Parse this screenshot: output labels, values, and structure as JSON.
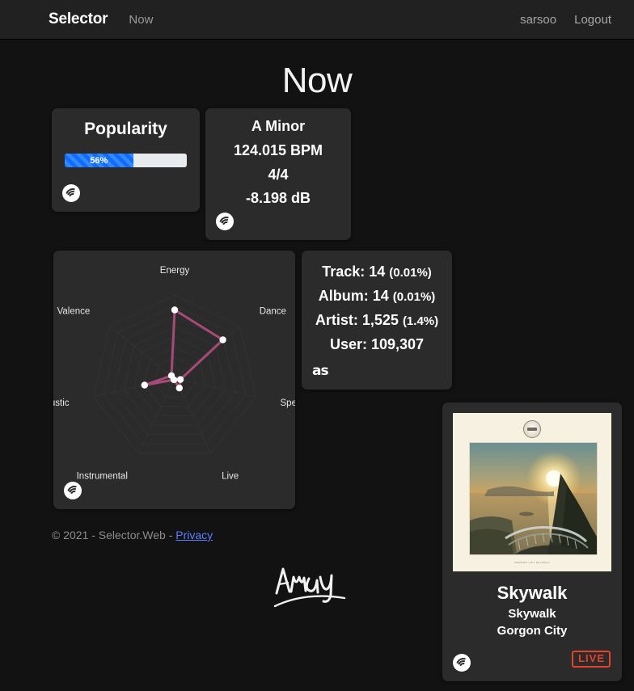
{
  "navbar": {
    "brand": "Selector",
    "page_link": "Now",
    "username": "sarsoo",
    "logout": "Logout"
  },
  "page": {
    "title": "Now"
  },
  "popularity_card": {
    "heading": "Popularity",
    "value_label": "56%",
    "value": 56,
    "source_icon": "spotify-icon",
    "bar_color": "#0d6efd",
    "track_color": "#e9ecef"
  },
  "key_card": {
    "lines": [
      "A Minor",
      "124.015 BPM",
      "4/4",
      "-8.198 dB"
    ],
    "source_icon": "spotify-icon"
  },
  "counts_card": {
    "rows": [
      {
        "label": "Track: 14",
        "pct": "(0.01%)"
      },
      {
        "label": "Album: 14",
        "pct": "(0.01%)"
      },
      {
        "label": "Artist: 1,525",
        "pct": "(1.4%)"
      },
      {
        "label": "User: 109,307",
        "pct": ""
      }
    ],
    "source_icon": "lastfm-icon",
    "lastfm_glyph": "as"
  },
  "radar_card": {
    "source_icon": "spotify-icon"
  },
  "chart_data": {
    "type": "radar",
    "title": "",
    "categories": [
      "Energy",
      "Dance",
      "Speech",
      "Live",
      "Instrumental",
      "Acoustic",
      "Valence"
    ],
    "values": [
      0.82,
      0.74,
      0.07,
      0.13,
      0.02,
      0.37,
      0.05
    ],
    "range": [
      0,
      1
    ],
    "rings": 8,
    "grid": true,
    "legend": "none",
    "line_color": "#a84a78",
    "point_color": "#ffffff",
    "grid_color": "#3a3a3a",
    "label_color": "#e8e8e8"
  },
  "track_card": {
    "track_name": "Skywalk",
    "album_name": "Skywalk",
    "artist_name": "Gorgon City",
    "badge": "LIVE",
    "badge_color": "#e8412a",
    "sleeve_caption": "GORGON CITY SKYWALK",
    "source_icon": "spotify-icon",
    "art_description": "sunset-over-ocean-with-boardwalk"
  },
  "footer": {
    "copyright": "© 2021 - Selector.Web -",
    "privacy_link": "Privacy",
    "signature": "Andy"
  }
}
